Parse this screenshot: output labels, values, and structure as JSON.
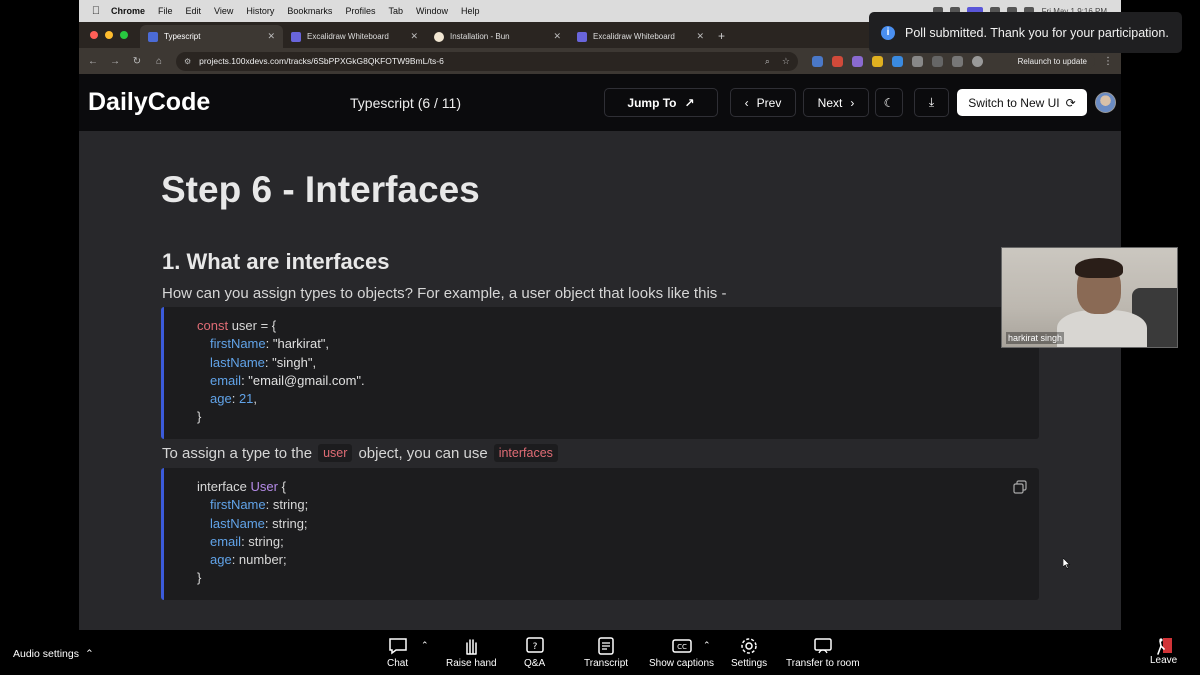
{
  "mac_menubar": {
    "items": [
      "Chrome",
      "File",
      "Edit",
      "View",
      "History",
      "Bookmarks",
      "Profiles",
      "Tab",
      "Window",
      "Help"
    ],
    "clock": "Fri May 1  9:16 PM"
  },
  "chrome": {
    "tabs": [
      {
        "label": "Typescript",
        "active": true,
        "favicon_color": "#4b6bd6"
      },
      {
        "label": "Excalidraw Whiteboard",
        "active": false,
        "favicon_color": "#6965db"
      },
      {
        "label": "Installation - Bun",
        "active": false,
        "favicon_color": "#f1e6d2"
      },
      {
        "label": "Excalidraw Whiteboard",
        "active": false,
        "favicon_color": "#6965db"
      }
    ],
    "url": "projects.100xdevs.com/tracks/6SbPPXGkG8QKFOTW9BmL/ts-6",
    "relaunch_label": "Relaunch to update"
  },
  "header": {
    "logo": "DailyCode",
    "track_title": "Typescript (6 / 11)",
    "jump_to": "Jump To",
    "prev": "Prev",
    "next": "Next",
    "switch_ui": "Switch to New UI"
  },
  "content": {
    "title": "Step 6 - Interfaces",
    "section_title": "1. What are interfaces",
    "para1": "How can you assign types to objects? For example, a user object that looks like this -",
    "code1": {
      "l1_kw": "const",
      "l1_rest": " user = {",
      "l2_prop": "firstName",
      "l2_rest": ": \"harkirat\",",
      "l3_prop": "lastName",
      "l3_rest": ": \"singh\",",
      "l4_prop": "email",
      "l4_rest": ": \"email@gmail.com\".",
      "l5_prop": "age",
      "l5_sep": ": ",
      "l5_num": "21",
      "l5_end": ",",
      "l6": "}"
    },
    "para2_a": "To assign a type to the",
    "para2_code1": "user",
    "para2_b": "object, you can use",
    "para2_code2": "interfaces",
    "code2": {
      "l1_kw": "interface",
      "l1_type": "User",
      "l1_end": " {",
      "l2_prop": "firstName",
      "l2_rest": ": string;",
      "l3_prop": "lastName",
      "l3_rest": ": string;",
      "l4_prop": "email",
      "l4_rest": ": string;",
      "l5_prop": "age",
      "l5_rest": ": number;",
      "l6": "}"
    }
  },
  "webcam": {
    "participant_name": "harkirat singh"
  },
  "toast": {
    "message": "Poll submitted. Thank you for your participation."
  },
  "meeting_bar": {
    "audio_settings": "Audio settings",
    "tools": {
      "chat": "Chat",
      "raise_hand": "Raise hand",
      "qa": "Q&A",
      "transcript": "Transcript",
      "show_captions": "Show captions",
      "settings": "Settings",
      "transfer": "Transfer to room"
    },
    "leave": "Leave"
  }
}
